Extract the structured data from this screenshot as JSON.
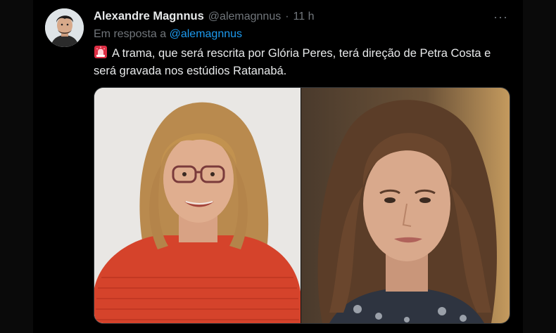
{
  "tweet": {
    "author_name": "Alexandre Magnnus",
    "author_handle": "@alemagnnus",
    "separator": "·",
    "time": "11 h",
    "more_label": "···",
    "reply_prefix": "Em resposta a",
    "reply_mention": "@alemagnnus",
    "text": "A trama, que  será rescrita por Glória Peres, terá direção de Petra Costa e será gravada nos estúdios Ratanabá."
  },
  "icons": {
    "avatar": "avatar-photo",
    "siren": "police-car-light-emoji",
    "more": "more-options-icon"
  },
  "colors": {
    "background": "#000000",
    "text": "#e7e9ea",
    "secondary": "#71767b",
    "link": "#1d9bf0"
  }
}
